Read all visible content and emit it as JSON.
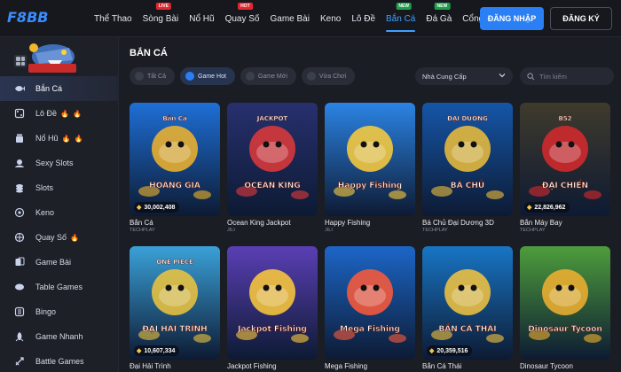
{
  "brand": {
    "logo_text": "F8BB",
    "accent": "#2a7ff5"
  },
  "nav": [
    {
      "label": "Thể Thao",
      "badge": ""
    },
    {
      "label": "Sòng Bài",
      "badge": "live",
      "badge_color": "red"
    },
    {
      "label": "Nổ Hũ",
      "badge": ""
    },
    {
      "label": "Quay Số",
      "badge": "hot",
      "badge_color": "red"
    },
    {
      "label": "Game Bài",
      "badge": ""
    },
    {
      "label": "Keno",
      "badge": ""
    },
    {
      "label": "Lô Đề",
      "badge": ""
    },
    {
      "label": "Bắn Cá",
      "badge": "new",
      "badge_color": "green",
      "active": true
    },
    {
      "label": "Đá Gà",
      "badge": "new",
      "badge_color": "green"
    },
    {
      "label": "Cổng Game",
      "badge": ""
    }
  ],
  "auth": {
    "login_label": "ĐĂNG NHẬP",
    "register_label": "ĐĂNG KÝ"
  },
  "sidebar": {
    "items": [
      {
        "label": "Bắn Cá",
        "icon": "fish-icon",
        "active": true,
        "fire": 0
      },
      {
        "label": "Lô Đề",
        "icon": "lottery-icon",
        "fire": 2
      },
      {
        "label": "Nổ Hũ",
        "icon": "jar-icon",
        "fire": 2
      },
      {
        "label": "Sexy Slots",
        "icon": "slots-icon",
        "fire": 0
      },
      {
        "label": "Slots",
        "icon": "coins-icon",
        "fire": 0
      },
      {
        "label": "Keno",
        "icon": "keno-icon",
        "fire": 0
      },
      {
        "label": "Quay Số",
        "icon": "wheel-icon",
        "fire": 1
      },
      {
        "label": "Game Bài",
        "icon": "cards-icon",
        "fire": 0
      },
      {
        "label": "Table Games",
        "icon": "table-icon",
        "fire": 0
      },
      {
        "label": "Bingo",
        "icon": "bingo-icon",
        "fire": 0
      },
      {
        "label": "Game Nhanh",
        "icon": "rocket-icon",
        "fire": 0
      },
      {
        "label": "Battle Games",
        "icon": "sword-icon",
        "fire": 0
      }
    ]
  },
  "main": {
    "title": "BẮN CÁ",
    "filters": [
      {
        "label": "Tất Cả",
        "active": false
      },
      {
        "label": "Game Hot",
        "active": true
      },
      {
        "label": "Game Mới",
        "active": false
      },
      {
        "label": "Vừa Chơi",
        "active": false
      }
    ],
    "provider_label": "Nhà Cung Cấp",
    "search_placeholder": "Tìm kiếm"
  },
  "games": [
    {
      "name": "Bắn Cá",
      "provider": "TECHPLAY",
      "jackpot": "30,002,408",
      "art_title": "HOÀNG GIA",
      "art_sub": "Bắn Cá",
      "colors": [
        "#1e6fd6",
        "#f3b52a"
      ]
    },
    {
      "name": "Ocean King Jackpot",
      "provider": "JILI",
      "jackpot": "",
      "art_title": "OCEAN KING",
      "art_sub": "JACKPOT",
      "colors": [
        "#27306e",
        "#e23a3a"
      ]
    },
    {
      "name": "Happy Fishing",
      "provider": "JILI",
      "jackpot": "",
      "art_title": "Happy Fishing",
      "art_sub": "",
      "colors": [
        "#2b84e4",
        "#ffcf3b"
      ]
    },
    {
      "name": "Bá Chủ Đại Dương 3D",
      "provider": "TECHPLAY",
      "jackpot": "",
      "art_title": "BÁ CHỦ",
      "art_sub": "ĐẠI DƯƠNG",
      "colors": [
        "#1556a8",
        "#f0c03a"
      ]
    },
    {
      "name": "Bắn Máy Bay",
      "provider": "TECHPLAY",
      "jackpot": "22,826,962",
      "art_title": "ĐẠI CHIẾN",
      "art_sub": "B52",
      "colors": [
        "#3f3a2c",
        "#d8292d"
      ]
    },
    {
      "name": "Đại Hải Trình",
      "provider": "",
      "jackpot": "10,607,334",
      "art_title": "ĐẠI HẢI TRÌNH",
      "art_sub": "ONE PIECE",
      "colors": [
        "#3aa1d8",
        "#f0c53c"
      ]
    },
    {
      "name": "Jackpot Fishing",
      "provider": "",
      "jackpot": "",
      "art_title": "Jackpot Fishing",
      "art_sub": "",
      "colors": [
        "#5a3fb5",
        "#ffcd3a"
      ]
    },
    {
      "name": "Mega Fishing",
      "provider": "",
      "jackpot": "",
      "art_title": "Mega Fishing",
      "art_sub": "",
      "colors": [
        "#1c66c7",
        "#ff5b3a"
      ]
    },
    {
      "name": "Bắn Cá Thái",
      "provider": "",
      "jackpot": "20,359,516",
      "art_title": "BẮN CÁ THÁI",
      "art_sub": "",
      "colors": [
        "#1875c4",
        "#f6c640"
      ]
    },
    {
      "name": "Dinosaur Tycoon",
      "provider": "",
      "jackpot": "",
      "art_title": "Dinosaur Tycoon",
      "art_sub": "",
      "colors": [
        "#4e9d3c",
        "#f3b230"
      ]
    }
  ]
}
